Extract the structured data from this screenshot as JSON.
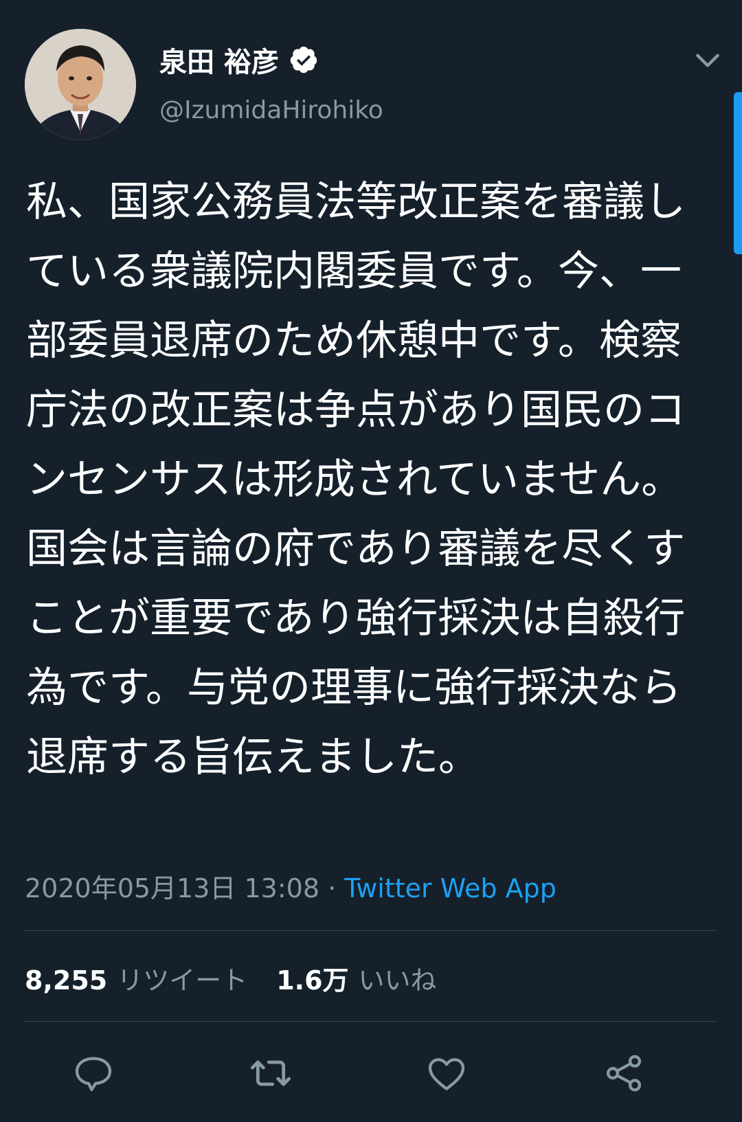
{
  "user": {
    "display_name": "泉田 裕彦",
    "handle": "@IzumidaHirohiko",
    "verified": true
  },
  "tweet": {
    "text": "私、国家公務員法等改正案を審議している衆議院内閣委員です。今、一部委員退席のため休憩中です。検察庁法の改正案は争点があり国民のコンセンサスは形成されていません。国会は言論の府であり審議を尽くすことが重要であり強行採決は自殺行為です。与党の理事に強行採決なら退席する旨伝えました。",
    "timestamp": "2020年05月13日 13:08",
    "separator": " · ",
    "source": "Twitter Web App"
  },
  "stats": {
    "retweets_count": "8,255",
    "retweets_label": "リツイート",
    "likes_count": "1.6万",
    "likes_label": "いいね"
  },
  "icons": {
    "verified": "verified-badge-icon",
    "menu": "chevron-down-icon",
    "reply": "reply-icon",
    "retweet": "retweet-icon",
    "like": "heart-icon",
    "share": "share-icon"
  },
  "colors": {
    "background": "#15202b",
    "text": "#ffffff",
    "secondary": "#8899a6",
    "accent": "#1da1f2",
    "divider": "#38444d"
  }
}
